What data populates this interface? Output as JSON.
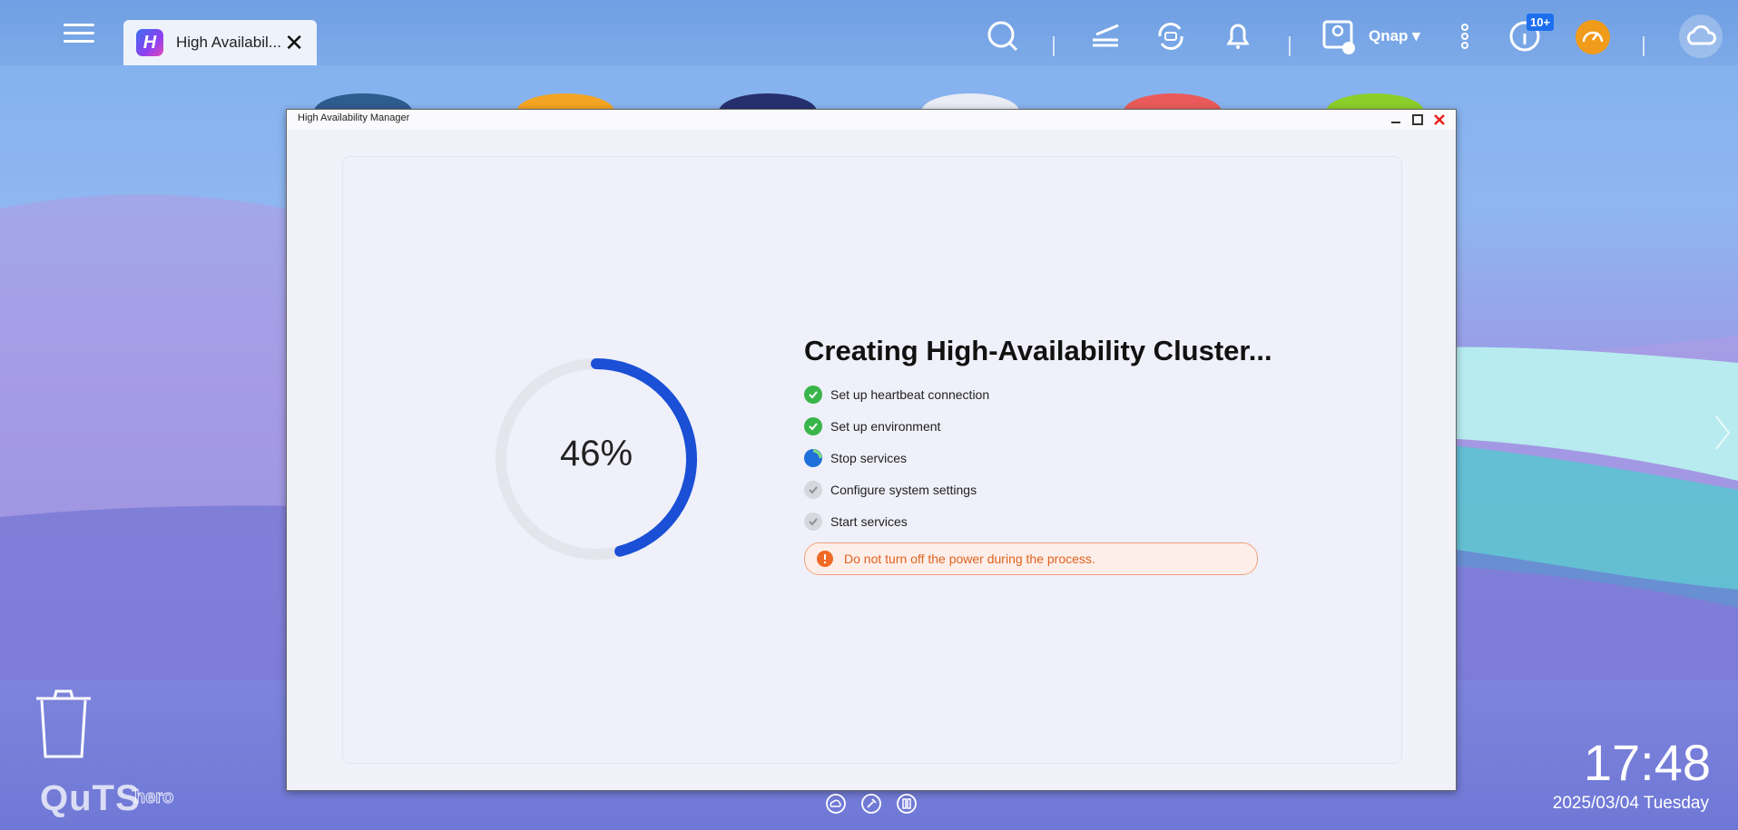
{
  "taskbar": {
    "tab_label": "High Availabil...",
    "tab_icon_letter": "H",
    "user_name": "Qnap ▾",
    "notification_badge": "10+"
  },
  "window": {
    "title": "High Availability Manager"
  },
  "progress": {
    "percent_text": "46%",
    "value": 0.46,
    "heading": "Creating High-Availability Cluster...",
    "steps": [
      {
        "label": "Set up heartbeat connection",
        "status": "done"
      },
      {
        "label": "Set up environment",
        "status": "done"
      },
      {
        "label": "Stop services",
        "status": "active"
      },
      {
        "label": "Configure system settings",
        "status": "pending"
      },
      {
        "label": "Start services",
        "status": "pending"
      }
    ],
    "warning": "Do not turn off the power during the process."
  },
  "desktop": {
    "brand": "QuTS",
    "brand_sub": "hero",
    "time": "17:48",
    "date": "2025/03/04 Tuesday"
  },
  "colors": {
    "accent": "#1a4fd6",
    "success": "#39b54a",
    "warning": "#e0631f"
  }
}
